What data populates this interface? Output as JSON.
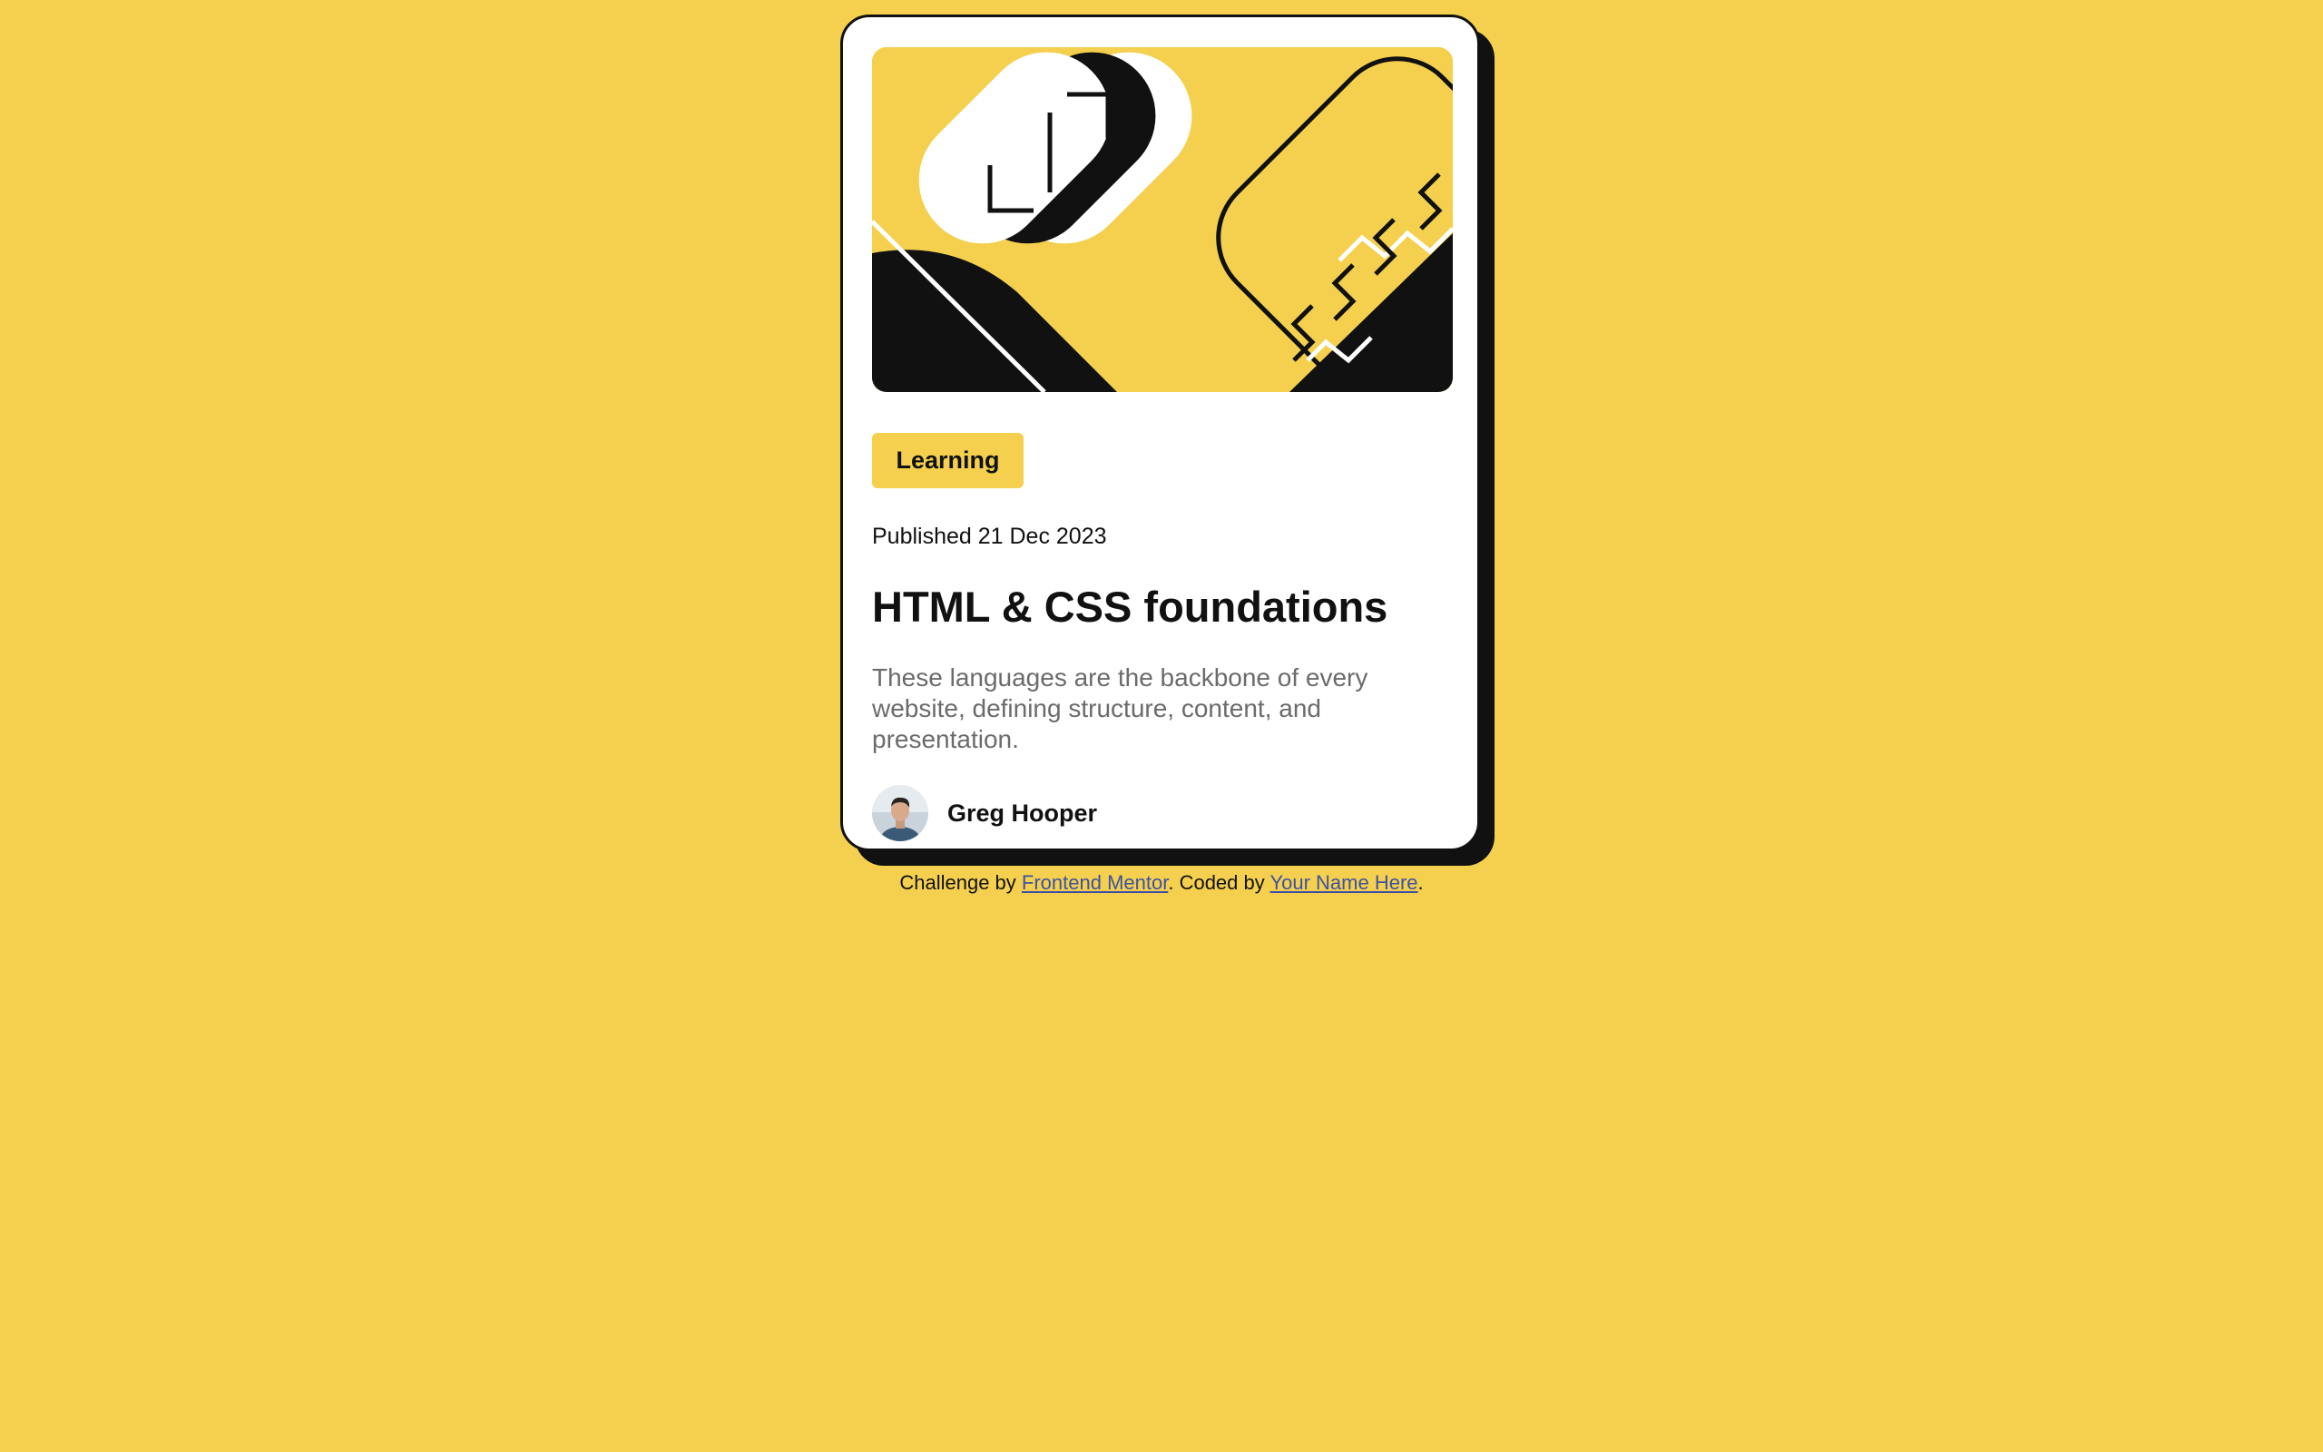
{
  "theme": {
    "background": "#F4D04E",
    "card_background": "#FFFFFF",
    "ink": "#111111",
    "muted_text": "#6B6B6B",
    "link": "#3E52A3"
  },
  "card": {
    "hero_image": "hero illustration",
    "tag": "Learning",
    "published": "Published 21 Dec 2023",
    "title": "HTML & CSS foundations",
    "description": "These languages are the backbone of every website, defining structure, content, and presentation.",
    "author": {
      "name": "Greg Hooper",
      "avatar": "avatar"
    }
  },
  "attribution": {
    "prefix": "Challenge by ",
    "link1": "Frontend Mentor",
    "middle": ". Coded by ",
    "link2": "Your Name Here",
    "suffix": "."
  }
}
